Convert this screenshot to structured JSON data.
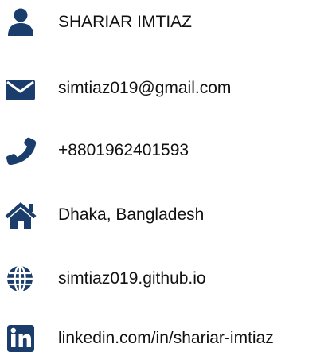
{
  "contact": {
    "icon_color": "#1a3d6b",
    "items": [
      {
        "icon": "user-icon",
        "text": "SHARIAR IMTIAZ"
      },
      {
        "icon": "envelope-icon",
        "text": "simtiaz019@gmail.com"
      },
      {
        "icon": "phone-icon",
        "text": "+8801962401593"
      },
      {
        "icon": "home-icon",
        "text": "Dhaka, Bangladesh"
      },
      {
        "icon": "globe-icon",
        "text": "simtiaz019.github.io"
      },
      {
        "icon": "linkedin-icon",
        "text": "linkedin.com/in/shariar-imtiaz"
      }
    ]
  }
}
